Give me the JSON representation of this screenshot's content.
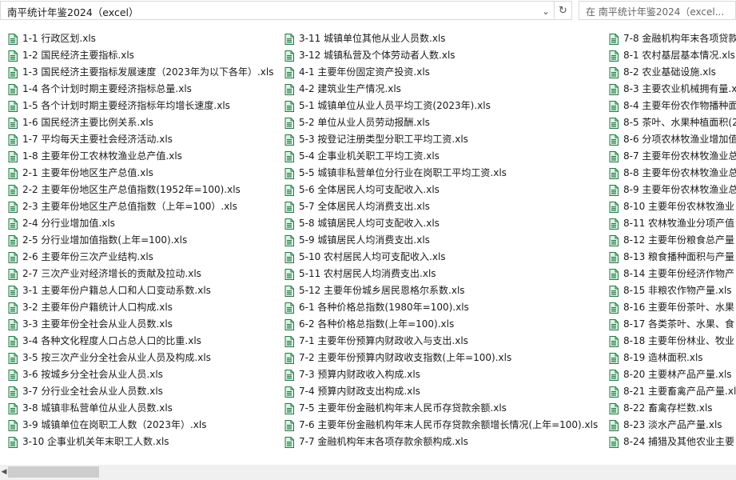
{
  "address_bar": {
    "path": "南平统计年鉴2024（excel）"
  },
  "search": {
    "placeholder": "在 南平统计年鉴2024（excel..."
  },
  "files": {
    "column1": [
      "1-1 行政区划.xls",
      "1-2 国民经济主要指标.xls",
      "1-3 国民经济主要指标发展速度（2023年为以下各年）.xls",
      "1-4 各个计划时期主要经济指标总量.xls",
      "1-5 各个计划时期主要经济指标年均增长速度.xls",
      "1-6 国民经济主要比例关系.xls",
      "1-7 平均每天主要社会经济活动.xls",
      "1-8 主要年份工农林牧渔业总产值.xls",
      "2-1 主要年份地区生产总值.xls",
      "2-2 主要年份地区生产总值指数(1952年=100).xls",
      "2-3 主要年份地区生产总值指数（上年=100）.xls",
      "2-4 分行业增加值.xls",
      "2-5 分行业增加值指数(上年=100).xls",
      "2-6 主要年份三次产业结构.xls",
      "2-7 三次产业对经济增长的贡献及拉动.xls",
      "3-1 主要年份户籍总人口和人口变动系数.xls",
      "3-2 主要年份户籍统计人口构成.xls",
      "3-3 主要年份全社会从业人员数.xls",
      "3-4 各种文化程度人口占总人口的比重.xls",
      "3-5 按三次产业分全社会从业人员及构成.xls",
      "3-6 按城乡分全社会从业人员.xls",
      "3-7 分行业全社会从业人员数.xls",
      "3-8 城镇非私营单位从业人员数.xls",
      "3-9 城镇单位在岗职工人数（2023年）.xls",
      "3-10 企事业机关年末职工人数.xls"
    ],
    "column2": [
      "3-11 城镇单位其他从业人员数.xls",
      "3-12 城镇私营及个体劳动者人数.xls",
      "4-1 主要年份固定资产投资.xls",
      "4-2 建筑业生产情况.xls",
      "5-1 城镇单位从业人员平均工资(2023年).xls",
      "5-2 单位从业人员劳动报酬.xls",
      "5-3 按登记注册类型分职工平均工资.xls",
      "5-4 企事业机关职工平均工资.xls",
      "5-5 城镇非私营单位分行业在岗职工平均工资.xls",
      "5-6 全体居民人均可支配收入.xls",
      "5-7 全体居民人均消费支出.xls",
      "5-8 城镇居民人均可支配收入.xls",
      "5-9 城镇居民人均消费支出.xls",
      "5-10 农村居民人均可支配收入.xls",
      "5-11 农村居民人均消费支出.xls",
      "5-12 主要年份城乡居民恩格尔系数.xls",
      "6-1 各种价格总指数(1980年=100).xls",
      "6-2 各种价格总指数(上年=100).xls",
      "7-1 主要年份预算内财政收入与支出.xls",
      "7-2 主要年份预算内财政收支指数(上年=100).xls",
      "7-3 预算内财政收入构成.xls",
      "7-4 预算内财政支出构成.xls",
      "7-5 主要年份金融机构年末人民币存贷款余额.xls",
      "7-6 主要年份金融机构年末人民币存贷款余额增长情况(上年=100).xls",
      "7-7 金融机构年末各项存款余额构成.xls"
    ],
    "column3": [
      "7-8 金融机构年末各项贷款",
      "8-1 农村基层基本情况.xls",
      "8-2 农业基础设施.xls",
      "8-3 主要农业机械拥有量.xl",
      "8-4 主要年份农作物播种面",
      "8-5 茶叶、水果种植面积(2",
      "8-6 分项农林牧渔业增加值",
      "8-7 主要年份农林牧渔业总",
      "8-8 主要年份农林牧渔业总",
      "8-9 主要年份农林牧渔业总",
      "8-10 主要年份农林牧渔业",
      "8-11 农林牧渔业分项产值",
      "8-12 主要年份粮食总产量",
      "8-13 粮食播种面积与产量",
      "8-14 主要年份经济作物产",
      "8-15 非粮农作物产量.xls",
      "8-16 主要年份茶叶、水果",
      "8-17 各类茶叶、水果、食",
      "8-18 主要年份林业、牧业",
      "8-19 造林面积.xls",
      "8-20 主要林产品产量.xls",
      "8-21 主要畜禽产品产量.xls",
      "8-22 畜禽存栏数.xls",
      "8-23 淡水产品产量.xls",
      "8-24 捕猎及其他农业主要"
    ]
  },
  "icons": {
    "address_chevron": "chevron-down-icon",
    "refresh": "refresh-icon",
    "file": "excel-file-icon",
    "scroll_left": "scroll-left-arrow-icon"
  },
  "colors": {
    "icon_green": "#1f7a45",
    "icon_fill": "#dff0e4",
    "scroll_track": "#f0f0f0",
    "scroll_thumb": "#cdcdcd"
  }
}
